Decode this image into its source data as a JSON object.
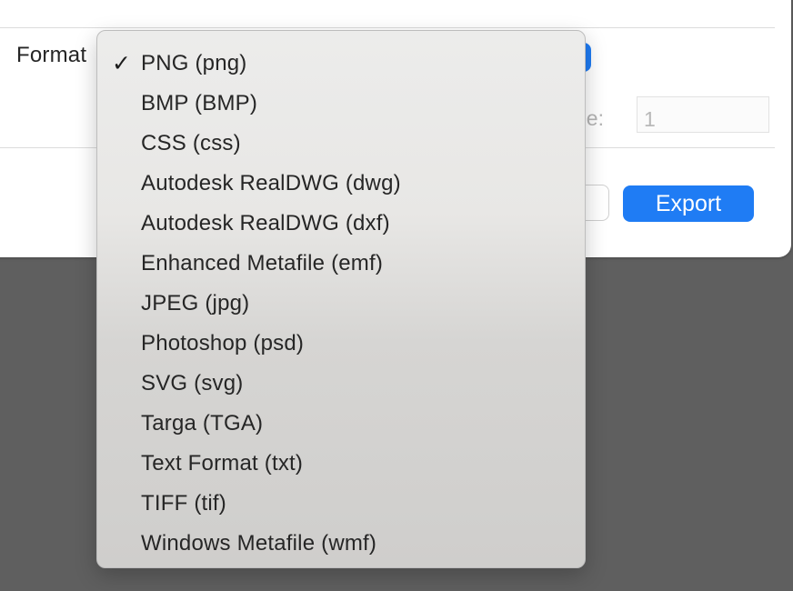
{
  "dialog": {
    "format_label": "Format",
    "range_label": "ge:",
    "range_value": "1",
    "export_label": "Export"
  },
  "format_menu": {
    "selected_index": 0,
    "check_glyph": "✓",
    "items": [
      {
        "label": "PNG (png)"
      },
      {
        "label": "BMP (BMP)"
      },
      {
        "label": "CSS (css)"
      },
      {
        "label": "Autodesk RealDWG (dwg)"
      },
      {
        "label": "Autodesk RealDWG (dxf)"
      },
      {
        "label": "Enhanced Metafile (emf)"
      },
      {
        "label": "JPEG (jpg)"
      },
      {
        "label": "Photoshop (psd)"
      },
      {
        "label": "SVG (svg)"
      },
      {
        "label": "Targa (TGA)"
      },
      {
        "label": "Text Format (txt)"
      },
      {
        "label": "TIFF (tif)"
      },
      {
        "label": "Windows Metafile (wmf)"
      }
    ]
  },
  "colors": {
    "accent": "#1f7cf4",
    "backdrop": "#5f5f5f"
  }
}
